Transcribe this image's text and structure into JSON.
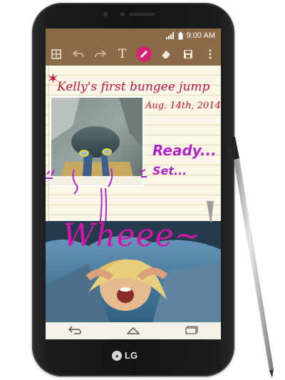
{
  "status": {
    "time": "9:00 AM"
  },
  "note": {
    "title": "Kelly's first bungee jump",
    "date": "Aug. 14th, 2014",
    "ready": "Ready...",
    "set": "Set...",
    "wheee": "Wheee~"
  },
  "toolbar": {
    "icons": [
      "grid-icon",
      "undo-icon",
      "redo-icon",
      "text-icon",
      "pen-icon",
      "eraser-icon",
      "save-icon",
      "more-icon"
    ],
    "text_label": "T"
  },
  "nav": {
    "icons": [
      "back-icon",
      "home-icon",
      "recent-apps-icon"
    ]
  },
  "brand": {
    "logo_text": "LG"
  },
  "colors": {
    "toolbar": "#8b6a48",
    "accent": "#d52273",
    "title_ink": "#c2143d",
    "purple_ink": "#b223c9",
    "pink_ink": "#d414a8"
  }
}
